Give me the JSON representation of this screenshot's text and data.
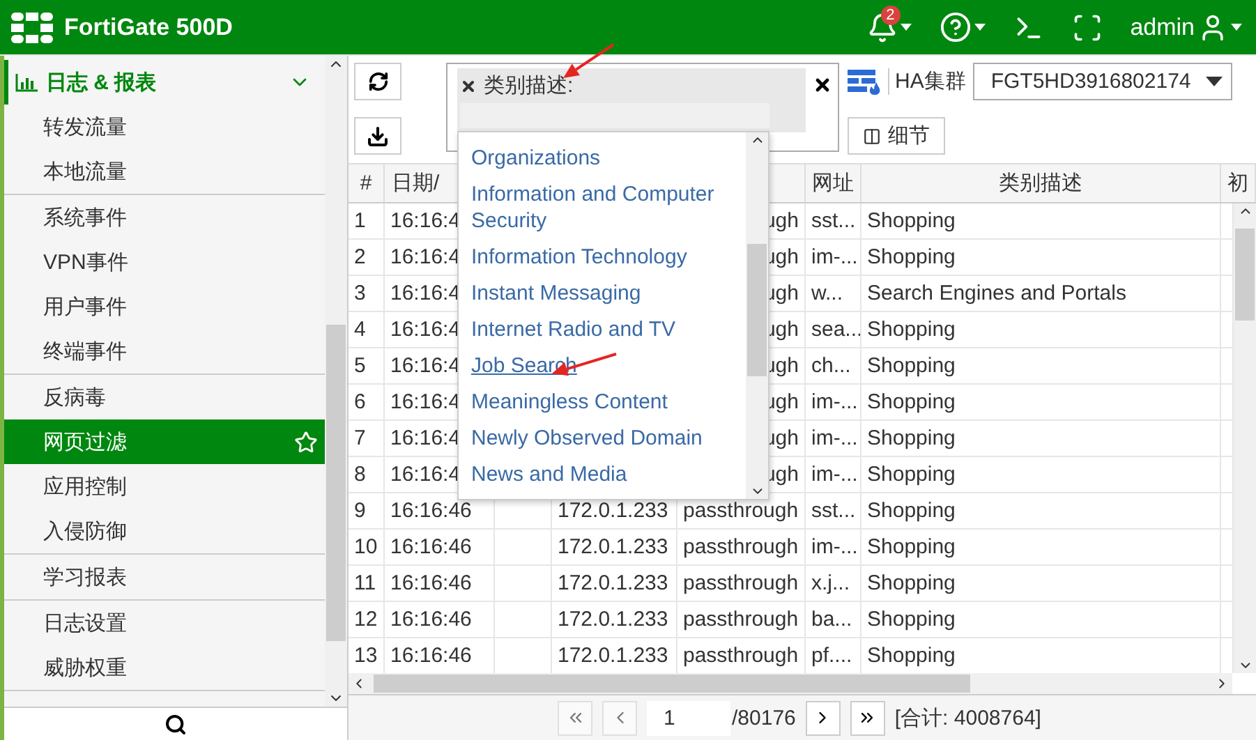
{
  "header": {
    "product": "FortiGate 500D",
    "notification_count": "2",
    "user": "admin"
  },
  "sidebar": {
    "section": {
      "label": "日志 & 报表",
      "expanded": true
    },
    "groups": [
      [
        {
          "label": "转发流量",
          "selected": false
        },
        {
          "label": "本地流量",
          "selected": false
        }
      ],
      [
        {
          "label": "系统事件",
          "selected": false
        },
        {
          "label": "VPN事件",
          "selected": false
        },
        {
          "label": "用户事件",
          "selected": false
        },
        {
          "label": "终端事件",
          "selected": false
        }
      ],
      [
        {
          "label": "反病毒",
          "selected": false
        },
        {
          "label": "网页过滤",
          "selected": true
        },
        {
          "label": "应用控制",
          "selected": false
        },
        {
          "label": "入侵防御",
          "selected": false
        }
      ],
      [
        {
          "label": "学习报表",
          "selected": false
        }
      ],
      [
        {
          "label": "日志设置",
          "selected": false
        },
        {
          "label": "威胁权重",
          "selected": false
        }
      ]
    ]
  },
  "toolbar": {
    "filter": {
      "label": "类别描述:",
      "options": [
        {
          "label": "Organizations",
          "hovered": false
        },
        {
          "label": "Information and Computer Security",
          "hovered": false
        },
        {
          "label": "Information Technology",
          "hovered": false
        },
        {
          "label": "Instant Messaging",
          "hovered": false
        },
        {
          "label": "Internet Radio and TV",
          "hovered": false
        },
        {
          "label": "Job Search",
          "hovered": true
        },
        {
          "label": "Meaningless Content",
          "hovered": false
        },
        {
          "label": "Newly Observed Domain",
          "hovered": false
        },
        {
          "label": "News and Media",
          "hovered": false
        }
      ]
    },
    "ha_label": "HA集群",
    "ha_select": "FGT5HD3916802174",
    "details_button": "细节"
  },
  "table": {
    "columns": [
      {
        "label": "#"
      },
      {
        "label": "日期/"
      },
      {},
      {},
      {},
      {
        "label": "网址"
      },
      {
        "label": "类别描述"
      },
      {
        "label": "初"
      }
    ],
    "rows": [
      {
        "number": "1",
        "time": "16:16:4",
        "action": "ugh",
        "url": "sst...",
        "category": "Shopping",
        "covered": true
      },
      {
        "number": "2",
        "time": "16:16:4",
        "action": "ugh",
        "url": "im-...",
        "category": "Shopping",
        "covered": true
      },
      {
        "number": "3",
        "time": "16:16:4",
        "action": "ugh",
        "url": "w...",
        "category": "Search Engines and Portals",
        "covered": true
      },
      {
        "number": "4",
        "time": "16:16:4",
        "action": "ugh",
        "url": "sea...",
        "category": "Shopping",
        "covered": true
      },
      {
        "number": "5",
        "time": "16:16:4",
        "action": "ugh",
        "url": "ch...",
        "category": "Shopping",
        "covered": true
      },
      {
        "number": "6",
        "time": "16:16:4",
        "action": "ugh",
        "url": "im-...",
        "category": "Shopping",
        "covered": true
      },
      {
        "number": "7",
        "time": "16:16:4",
        "action": "ugh",
        "url": "im-...",
        "category": "Shopping",
        "covered": true
      },
      {
        "number": "8",
        "time": "16:16:4",
        "action": "ugh",
        "url": "im-...",
        "category": "Shopping",
        "covered": true
      },
      {
        "number": "9",
        "time": "16:16:46",
        "ip": "172.0.1.233",
        "action": "passthrough",
        "url": "sst...",
        "category": "Shopping",
        "covered": false
      },
      {
        "number": "10",
        "time": "16:16:46",
        "ip": "172.0.1.233",
        "action": "passthrough",
        "url": "im-...",
        "category": "Shopping",
        "covered": false
      },
      {
        "number": "11",
        "time": "16:16:46",
        "ip": "172.0.1.233",
        "action": "passthrough",
        "url": "x.j...",
        "category": "Shopping",
        "covered": false
      },
      {
        "number": "12",
        "time": "16:16:46",
        "ip": "172.0.1.233",
        "action": "passthrough",
        "url": "ba...",
        "category": "Shopping",
        "covered": false
      },
      {
        "number": "13",
        "time": "16:16:46",
        "ip": "172.0.1.233",
        "action": "passthrough",
        "url": "pf....",
        "category": "Shopping",
        "covered": false
      }
    ]
  },
  "pager": {
    "page": "1",
    "total_pages": "/80176",
    "count": "[合计: 4008764]"
  }
}
